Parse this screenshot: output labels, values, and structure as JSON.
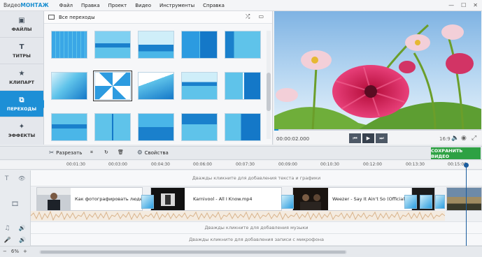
{
  "app": {
    "logo_prefix": "Видео",
    "logo_brand": "МОНТАЖ"
  },
  "menu": [
    "Файл",
    "Правка",
    "Проект",
    "Видео",
    "Инструменты",
    "Справка"
  ],
  "window_controls": [
    "—",
    "☐",
    "✕"
  ],
  "sidebar": {
    "items": [
      {
        "label": "ФАЙЛЫ",
        "icon": "image-icon",
        "glyph": "▣"
      },
      {
        "label": "ТИТРЫ",
        "icon": "title-t-icon",
        "glyph": "T"
      },
      {
        "label": "КЛИПАРТ",
        "icon": "star-icon",
        "glyph": "★"
      },
      {
        "label": "ПЕРЕХОДЫ",
        "icon": "transitions-icon",
        "glyph": "⧉"
      },
      {
        "label": "ЭФФЕКТЫ",
        "icon": "magic-wand-icon",
        "glyph": "✦"
      }
    ],
    "active_index": 3
  },
  "gallery": {
    "title": "Все переходы",
    "shuffle_icon": "⤮",
    "view_icon": "▭"
  },
  "preview": {
    "time": "00:00:02.000",
    "ratio": "16:9",
    "progress": 0.02,
    "buttons": {
      "prev": "⏮",
      "play": "▶",
      "next": "⏭"
    },
    "icons": {
      "volume": "🔈",
      "snapshot": "◉",
      "fullscreen": "⤢"
    }
  },
  "toolbar": {
    "cut_label": "Разрезать",
    "cut_icon": "✂",
    "crop_icon": "⌗",
    "rotate_icon": "↻",
    "delete_icon": "🗑",
    "props_label": "Свойства",
    "props_icon": "⚙",
    "save_label": "СОХРАНИТЬ ВИДЕО"
  },
  "ruler": [
    "00:01:30",
    "00:03:00",
    "00:04:30",
    "00:06:00",
    "00:07:30",
    "00:09:00",
    "00:10:30",
    "00:12:00",
    "00:13:30",
    "00:15:00"
  ],
  "tracks": {
    "text_hint": "Дважды кликните для добавления текста и графики",
    "music_hint": "Дважды кликните для добавления музыки",
    "voice_hint": "Дважды кликните для добавления записи с микрофона",
    "icons": {
      "text": "T",
      "eye": "👁",
      "video": "🎞",
      "music": "♫",
      "speaker": "🔊",
      "mic": "🎤"
    }
  },
  "clips": [
    {
      "label": "Как фотографировать людей."
    },
    {
      "label": "Karnivool - All I Know.mp4"
    },
    {
      "label": "Weezer - Say It Ain't So (Official Mus"
    }
  ],
  "bottom": {
    "zoom_minus": "−",
    "zoom_value": "6%",
    "zoom_plus": "+"
  }
}
